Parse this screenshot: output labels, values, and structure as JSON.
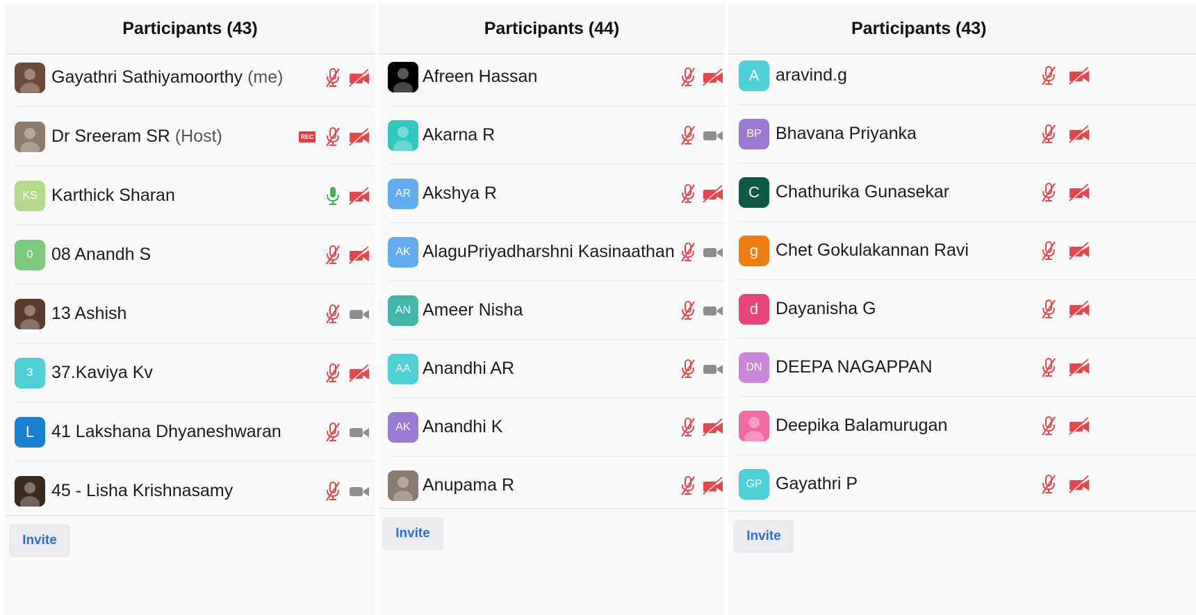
{
  "panels": [
    {
      "title": "Participants (43)",
      "invite_label": "Invite",
      "participants": [
        {
          "name": "Gayathri Sathiyamoorthy",
          "role": "(me)",
          "avatar": {
            "type": "photo",
            "initials": "",
            "color": "#6b4a3a"
          },
          "recording": false,
          "mic": "muted",
          "video": "off"
        },
        {
          "name": "Dr Sreeram SR",
          "role": "(Host)",
          "avatar": {
            "type": "photo",
            "initials": "",
            "color": "#8d7a6a"
          },
          "recording": true,
          "rec_label": "REC",
          "mic": "muted",
          "video": "off"
        },
        {
          "name": "Karthick Sharan",
          "role": "",
          "avatar": {
            "type": "initials",
            "initials": "KS",
            "color": "#b5d98a"
          },
          "recording": false,
          "mic": "on",
          "video": "off"
        },
        {
          "name": "08 Anandh S",
          "role": "",
          "avatar": {
            "type": "initials",
            "initials": "0",
            "color": "#7cca7e"
          },
          "recording": false,
          "mic": "muted",
          "video": "off"
        },
        {
          "name": "13 Ashish",
          "role": "",
          "avatar": {
            "type": "photo",
            "initials": "",
            "color": "#5a3b2c"
          },
          "recording": false,
          "mic": "muted",
          "video": "available"
        },
        {
          "name": "37.Kaviya Kv",
          "role": "",
          "avatar": {
            "type": "initials",
            "initials": "3",
            "color": "#4dd0d6"
          },
          "recording": false,
          "mic": "muted",
          "video": "off"
        },
        {
          "name": "41 Lakshana Dhyaneshwaran",
          "role": "",
          "avatar": {
            "type": "initials",
            "initials": "L",
            "color": "#1a7fd0"
          },
          "recording": false,
          "mic": "muted",
          "video": "available"
        },
        {
          "name": "45 - Lisha Krishnasamy",
          "role": "",
          "avatar": {
            "type": "photo",
            "initials": "",
            "color": "#3b2a1e"
          },
          "recording": false,
          "mic": "muted",
          "video": "available"
        }
      ]
    },
    {
      "title": "Participants (44)",
      "invite_label": "Invite",
      "participants": [
        {
          "name": "Afreen Hassan",
          "role": "",
          "avatar": {
            "type": "photo",
            "initials": "",
            "color": "#000000"
          },
          "recording": false,
          "mic": "muted",
          "video": "off"
        },
        {
          "name": "Akarna R",
          "role": "",
          "avatar": {
            "type": "photo",
            "initials": "",
            "color": "#2fc7c0"
          },
          "recording": false,
          "mic": "muted",
          "video": "available"
        },
        {
          "name": "Akshya R",
          "role": "",
          "avatar": {
            "type": "initials",
            "initials": "AR",
            "color": "#63acef"
          },
          "recording": false,
          "mic": "muted",
          "video": "off"
        },
        {
          "name": "AlaguPriyadharshni Kasinaathan",
          "role": "",
          "avatar": {
            "type": "initials",
            "initials": "AK",
            "color": "#63acef"
          },
          "recording": false,
          "mic": "muted",
          "video": "available"
        },
        {
          "name": "Ameer Nisha",
          "role": "",
          "avatar": {
            "type": "initials",
            "initials": "AN",
            "color": "#42b6a6"
          },
          "recording": false,
          "mic": "muted",
          "video": "available"
        },
        {
          "name": "Anandhi AR",
          "role": "",
          "avatar": {
            "type": "initials",
            "initials": "AA",
            "color": "#4dd0d6"
          },
          "recording": false,
          "mic": "muted",
          "video": "available"
        },
        {
          "name": "Anandhi K",
          "role": "",
          "avatar": {
            "type": "initials",
            "initials": "AK",
            "color": "#9b7ad6"
          },
          "recording": false,
          "mic": "muted",
          "video": "off"
        },
        {
          "name": "Anupama R",
          "role": "",
          "avatar": {
            "type": "photo",
            "initials": "",
            "color": "#8a7b6f"
          },
          "recording": false,
          "mic": "muted",
          "video": "off"
        }
      ]
    },
    {
      "title": "Participants (43)",
      "invite_label": "Invite",
      "participants": [
        {
          "name": "aravind.g",
          "role": "",
          "avatar": {
            "type": "initials",
            "initials": "A",
            "color": "#4dd0d6"
          },
          "recording": false,
          "mic": "muted",
          "video": "off"
        },
        {
          "name": "Bhavana Priyanka",
          "role": "",
          "avatar": {
            "type": "initials",
            "initials": "BP",
            "color": "#9b7ad6"
          },
          "recording": false,
          "mic": "muted",
          "video": "off"
        },
        {
          "name": "Chathurika Gunasekar",
          "role": "",
          "avatar": {
            "type": "initials",
            "initials": "C",
            "color": "#0f5a44"
          },
          "recording": false,
          "mic": "muted",
          "video": "off"
        },
        {
          "name": "Chet Gokulakannan Ravi",
          "role": "",
          "avatar": {
            "type": "initials",
            "initials": "g",
            "color": "#f07d10"
          },
          "recording": false,
          "mic": "muted",
          "video": "off"
        },
        {
          "name": "Dayanisha G",
          "role": "",
          "avatar": {
            "type": "initials",
            "initials": "d",
            "color": "#e8457f"
          },
          "recording": false,
          "mic": "muted",
          "video": "off"
        },
        {
          "name": "DEEPA NAGAPPAN",
          "role": "",
          "avatar": {
            "type": "initials",
            "initials": "DN",
            "color": "#cb86d9"
          },
          "recording": false,
          "mic": "muted",
          "video": "off"
        },
        {
          "name": "Deepika Balamurugan",
          "role": "",
          "avatar": {
            "type": "photo",
            "initials": "",
            "color": "#f06aa4"
          },
          "recording": false,
          "mic": "muted",
          "video": "off"
        },
        {
          "name": "Gayathri P",
          "role": "",
          "avatar": {
            "type": "initials",
            "initials": "GP",
            "color": "#4dd0d6"
          },
          "recording": false,
          "mic": "muted",
          "video": "off"
        }
      ]
    }
  ],
  "colors": {
    "muted_red": "#e8454a",
    "mic_on_green": "#43b14a",
    "camera_grey": "#8e8e8e",
    "invite_blue": "#2a6fd6"
  },
  "icons": {
    "mic_muted": "mic-muted-icon",
    "mic_on": "mic-icon",
    "video_off": "video-off-icon",
    "video_available": "video-camera-icon",
    "recording": "recording-badge"
  }
}
